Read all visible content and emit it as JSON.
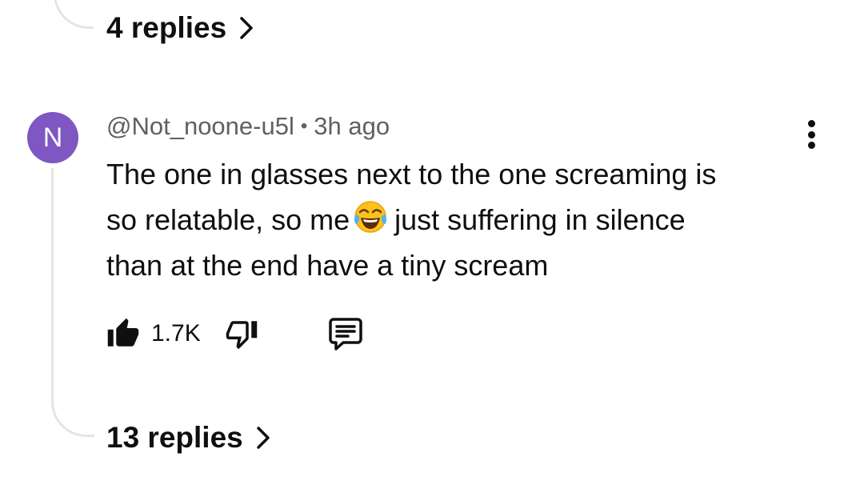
{
  "thread": {
    "previous_replies_label": "4 replies",
    "comment": {
      "avatar_letter": "N",
      "avatar_color": "#7e57c2",
      "author": "@Not_noone-u5l",
      "separator": "•",
      "time": "3h ago",
      "text_lines": [
        "The one in glasses next to the one screaming is",
        "so relatable, so me",
        "just suffering in silence",
        "than at the end have a tiny scream"
      ],
      "emoji": "face-with-tears-of-joy",
      "likes": "1.7K",
      "replies_label": "13 replies"
    }
  },
  "icons": {
    "more": "more-vertical-icon",
    "like": "thumbs-up-filled-icon",
    "dislike": "thumbs-down-outline-icon",
    "reply": "comment-reply-icon",
    "chevron": "chevron-right-icon"
  }
}
